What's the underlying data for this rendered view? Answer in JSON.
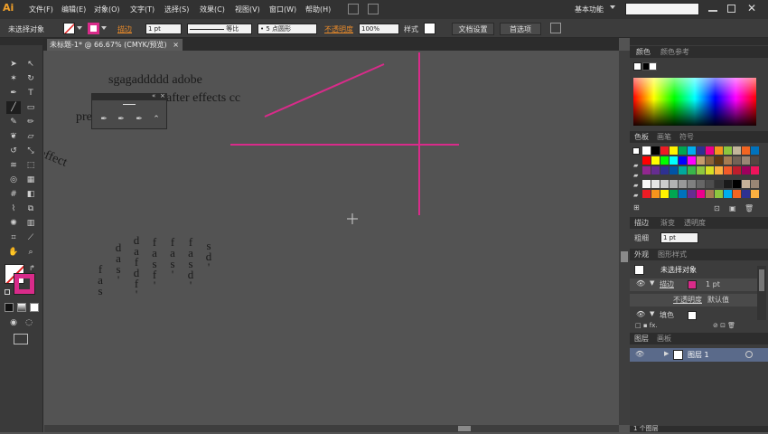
{
  "app": {
    "logo": "Ai"
  },
  "menu": [
    "文件(F)",
    "编辑(E)",
    "对象(O)",
    "文字(T)",
    "选择(S)",
    "效果(C)",
    "视图(V)",
    "窗口(W)",
    "帮助(H)"
  ],
  "workspace": {
    "label": "基本功能",
    "search_value": ""
  },
  "control": {
    "selection": "未选择对象",
    "stroke_label": "描边",
    "stroke_weight": "1 pt",
    "line_style": "等比",
    "brush": "5 点圆形",
    "opacity_label": "不透明度",
    "opacity_value": "100%",
    "style_label": "样式",
    "doc_setup": "文档设置",
    "preferences": "首选项"
  },
  "document": {
    "tab_title": "未标题-1* @ 66.67% (CMYK/预览)"
  },
  "canvas": {
    "line1": "sgagaddddd adobe",
    "line2": "after effects cc",
    "pre": "pre",
    "effect": "effect",
    "vertical_cols": [
      [
        "f",
        "a",
        "s"
      ],
      [
        "d",
        "a",
        "s",
        "'"
      ],
      [
        "d",
        "a",
        "f",
        "d",
        "f",
        "'"
      ],
      [
        "f",
        "a",
        "s",
        "f",
        "'"
      ],
      [
        "f",
        "a",
        "s",
        "'"
      ],
      [
        "f",
        "a",
        "s",
        "d",
        "'"
      ],
      [
        "s",
        "d",
        "'"
      ]
    ]
  },
  "colors": {
    "accent_magenta": "#d92b8a",
    "canvas_bg": "#535353",
    "ui_dark": "#323232"
  },
  "panels": {
    "color_tab": "颜色",
    "color_ref_tab": "颜色参考",
    "swatches_tab": "色板",
    "brushes_tab": "画笔",
    "symbols_tab": "符号",
    "stroke_tab": "描边",
    "gradient_tab": "渐变",
    "transparency_tab": "透明度",
    "weight_label": "粗细",
    "weight_value": "1 pt",
    "appearance_tab": "外观",
    "graphic_styles_tab": "图形样式",
    "appearance_title": "未选择对象",
    "app_stroke": "描边",
    "app_stroke_value": "1 pt",
    "app_opacity": "不透明度",
    "app_opacity_value": "默认值",
    "app_fill": "填色",
    "layers_tab": "图层",
    "artboards_tab": "画板",
    "layer_name": "图层 1",
    "layer_count": "1 个图层"
  },
  "swatch_colors": [
    [
      "#ffffff",
      "#000000",
      "#ed1c24",
      "#fff200",
      "#00a651",
      "#00aeef",
      "#2e3192",
      "#ec008c",
      "#f7941d",
      "#8dc63f",
      "#c2b59b",
      "#f26522",
      "#0072bc"
    ],
    [
      "#ff0000",
      "#ffff00",
      "#00ff00",
      "#00ffff",
      "#0000ff",
      "#ff00ff",
      "#c69c6d",
      "#8c6239",
      "#603913",
      "#a67c52",
      "#736357",
      "#998675",
      "#534741"
    ],
    [
      "#92278f",
      "#662d91",
      "#2e3192",
      "#0054a6",
      "#00a99d",
      "#39b54a",
      "#8dc63f",
      "#d7df23",
      "#fbb040",
      "#f15a29",
      "#be1e2d",
      "#9e005d",
      "#ed145b"
    ],
    [
      "#f9f9f9",
      "#e6e6e6",
      "#cccccc",
      "#b3b3b3",
      "#999999",
      "#808080",
      "#666666",
      "#4d4d4d",
      "#333333",
      "#1a1a1a",
      "#000000",
      "#c7b299",
      "#998675"
    ],
    [
      "#ed1c24",
      "#f7941d",
      "#fff200",
      "#00a651",
      "#0072bc",
      "#662d91",
      "#ec008c",
      "#a67c52",
      "#8dc63f",
      "#00aeef",
      "#f26522",
      "#2e3192",
      "#fbb040"
    ]
  ]
}
